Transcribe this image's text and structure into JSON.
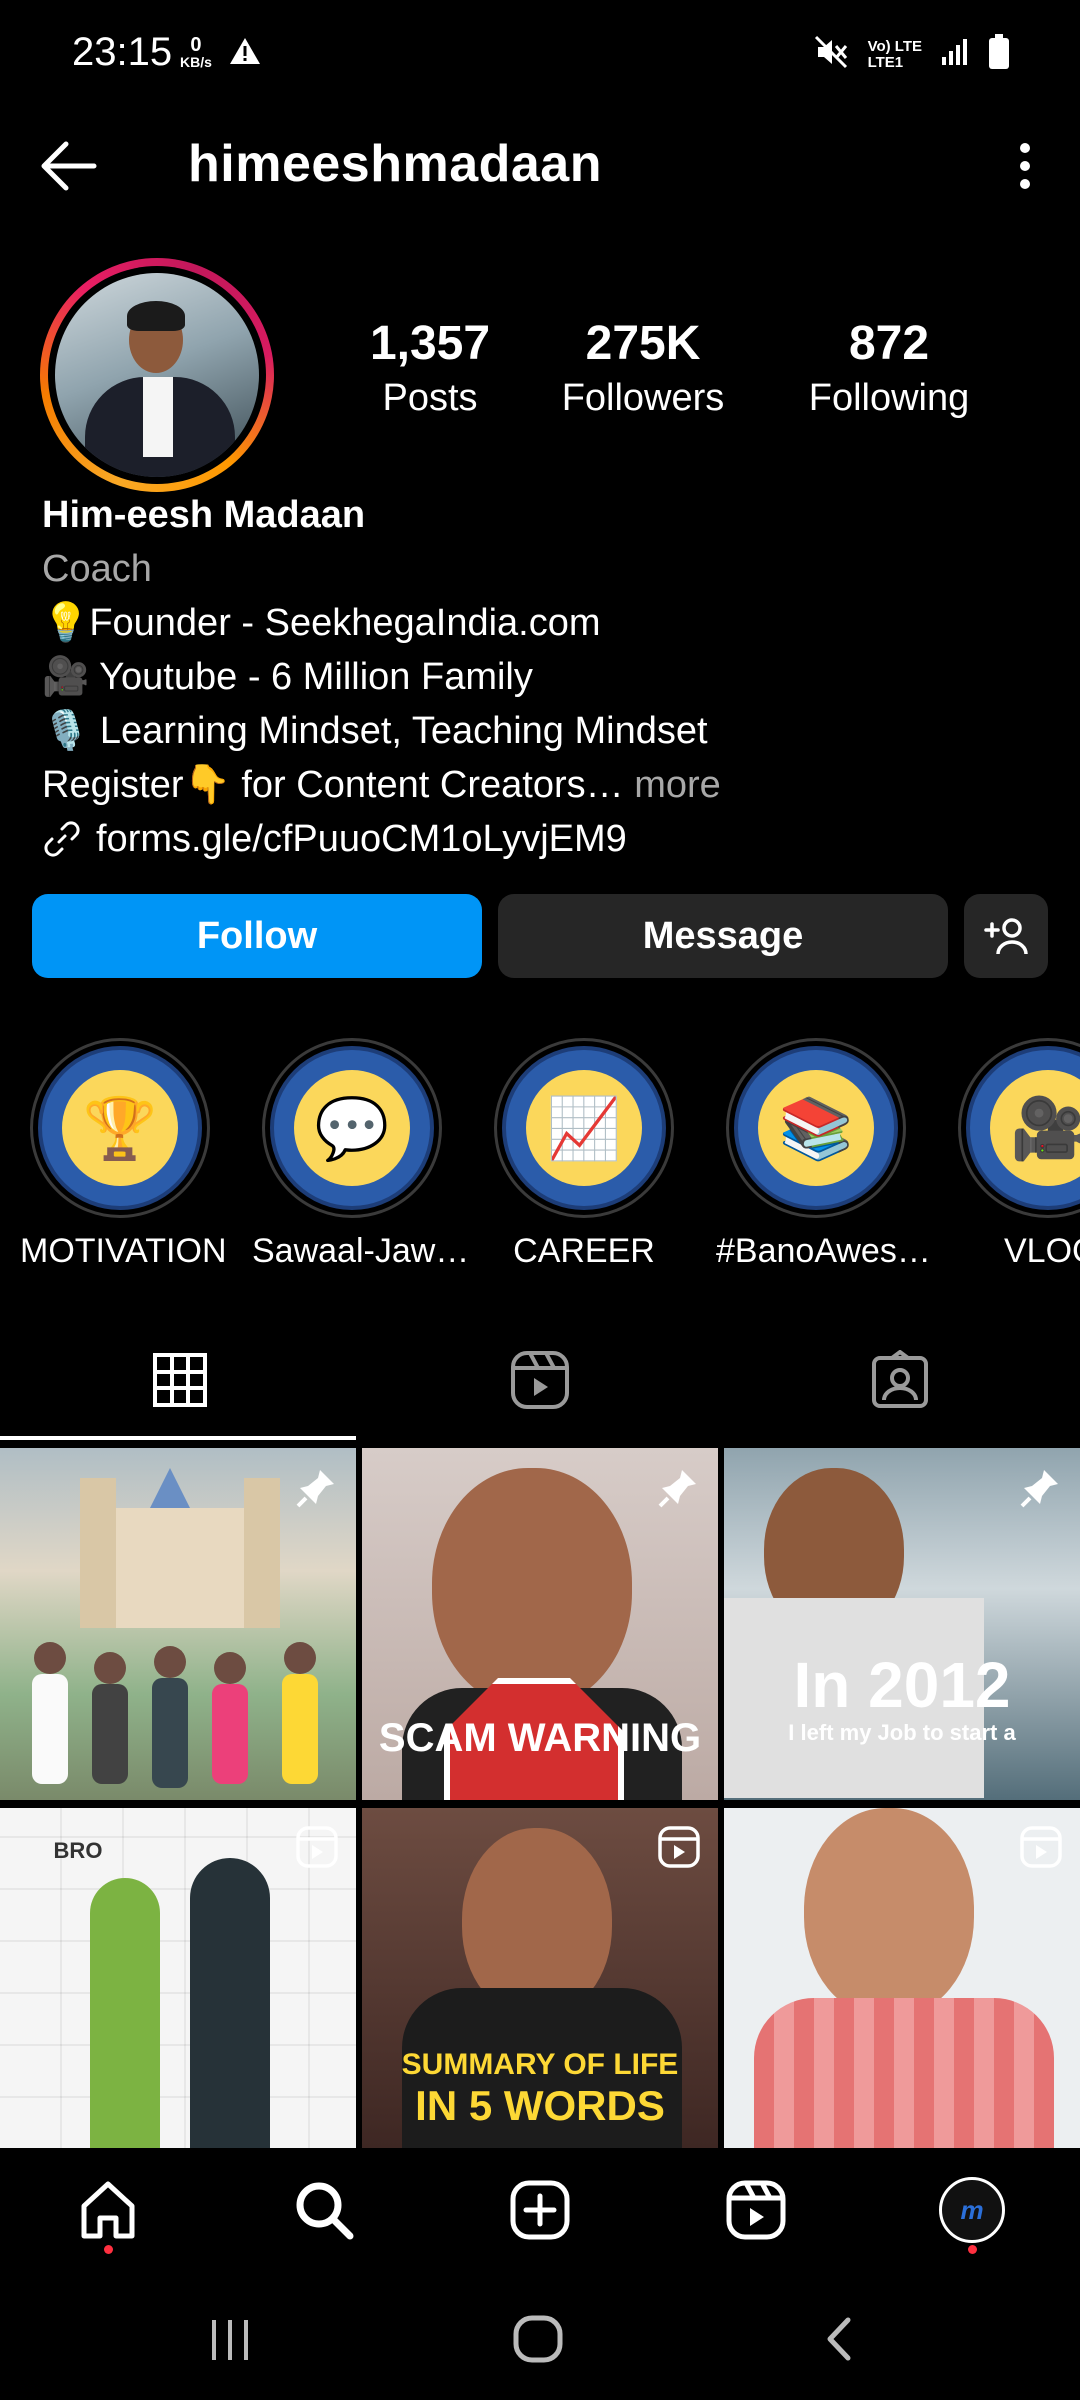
{
  "status_bar": {
    "time": "23:15",
    "speed_value": "0",
    "speed_unit": "KB/s",
    "network_top": "Vo) LTE",
    "network_bottom": "LTE1"
  },
  "header": {
    "username": "himeeshmadaan"
  },
  "profile": {
    "stats": [
      {
        "value": "1,357",
        "label": "Posts"
      },
      {
        "value": "275K",
        "label": "Followers"
      },
      {
        "value": "872",
        "label": "Following"
      }
    ],
    "display_name": "Him-eesh Madaan",
    "category": "Coach",
    "bio_lines": [
      "💡Founder - SeekhegaIndia.com",
      "🎥 Youtube - 6 Million Family",
      "🎙️ Learning Mindset, Teaching Mindset"
    ],
    "bio_last_line": "Register👇 for Content Creators…",
    "more_label": " more",
    "link": "forms.gle/cfPuuoCM1oLyvjEM9"
  },
  "actions": {
    "follow": "Follow",
    "message": "Message"
  },
  "highlights": [
    {
      "label": "MOTIVATION",
      "icon": "trophy-icon",
      "glyph": "🏆"
    },
    {
      "label": "Sawaal-Jaw…",
      "icon": "qa-icon",
      "glyph": "💬"
    },
    {
      "label": "CAREER",
      "icon": "career-ladder-icon",
      "glyph": "📈"
    },
    {
      "label": "#BanoAwes…",
      "icon": "books-icon",
      "glyph": "📚"
    },
    {
      "label": "VLOG",
      "icon": "camera-icon",
      "glyph": "🎥"
    }
  ],
  "grid_posts": [
    {
      "type": "pinned",
      "caption": ""
    },
    {
      "type": "pinned",
      "caption": "SCAM WARNING"
    },
    {
      "type": "pinned",
      "caption": "In 2012",
      "subcaption": "I left my Job to start a"
    },
    {
      "type": "reel",
      "caption": "BRO"
    },
    {
      "type": "reel",
      "caption": "SUMMARY OF LIFE",
      "subcaption": "IN 5 WORDS"
    },
    {
      "type": "reel",
      "caption": ""
    }
  ],
  "colors": {
    "accent_blue": "#0095f6",
    "button_gray": "#262626",
    "notification_red": "#ff3040"
  }
}
